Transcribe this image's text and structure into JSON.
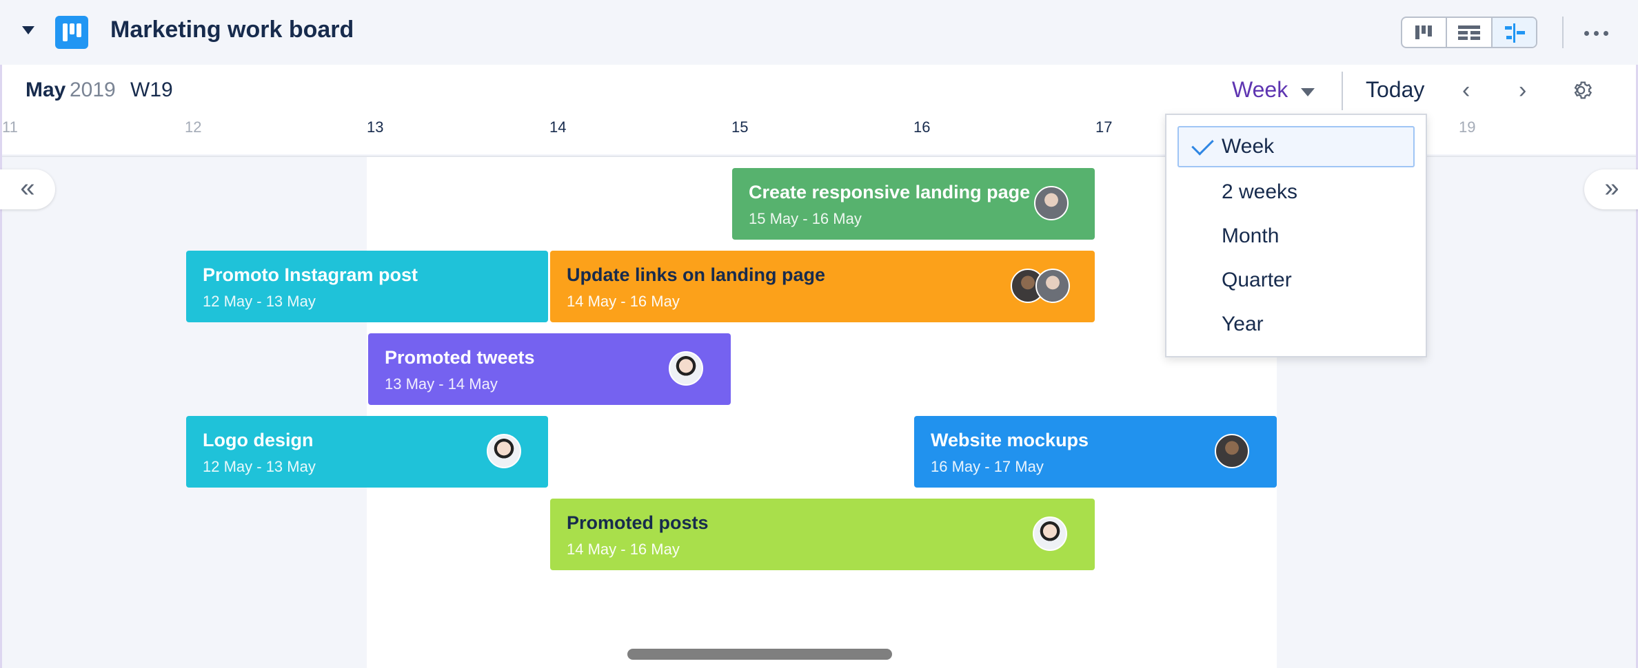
{
  "header": {
    "title": "Marketing work board",
    "more_icon": "more-horizontal-icon"
  },
  "toolbar": {
    "month": "May",
    "year": "2019",
    "week_number": "W19",
    "scale_selected": "Week",
    "today_label": "Today"
  },
  "timeline": {
    "ticks": [
      "11",
      "12",
      "13",
      "14",
      "15",
      "16",
      "17",
      "19"
    ]
  },
  "tasks": [
    {
      "title": "Create responsive landing page",
      "dates": "15 May - 16 May",
      "color": "#57b26e"
    },
    {
      "title": "Promoto Instagram post",
      "dates": "12 May - 13 May",
      "color": "#1fc2d9"
    },
    {
      "title": "Update links on landing page",
      "dates": "14 May - 16 May",
      "color": "#fca11a"
    },
    {
      "title": "Promoted tweets",
      "dates": "13 May - 14 May",
      "color": "#7562f0"
    },
    {
      "title": "Logo design",
      "dates": "12 May - 13 May",
      "color": "#1fc2d9"
    },
    {
      "title": "Website mockups",
      "dates": "16 May - 17 May",
      "color": "#2192ee"
    },
    {
      "title": "Promoted posts",
      "dates": "14 May - 16 May",
      "color": "#a9df4b"
    }
  ],
  "scale_menu": {
    "options": [
      "Week",
      "2 weeks",
      "Month",
      "Quarter",
      "Year"
    ],
    "selected_index": 0
  },
  "scroll": {
    "left_label": "«",
    "right_label": "»"
  }
}
